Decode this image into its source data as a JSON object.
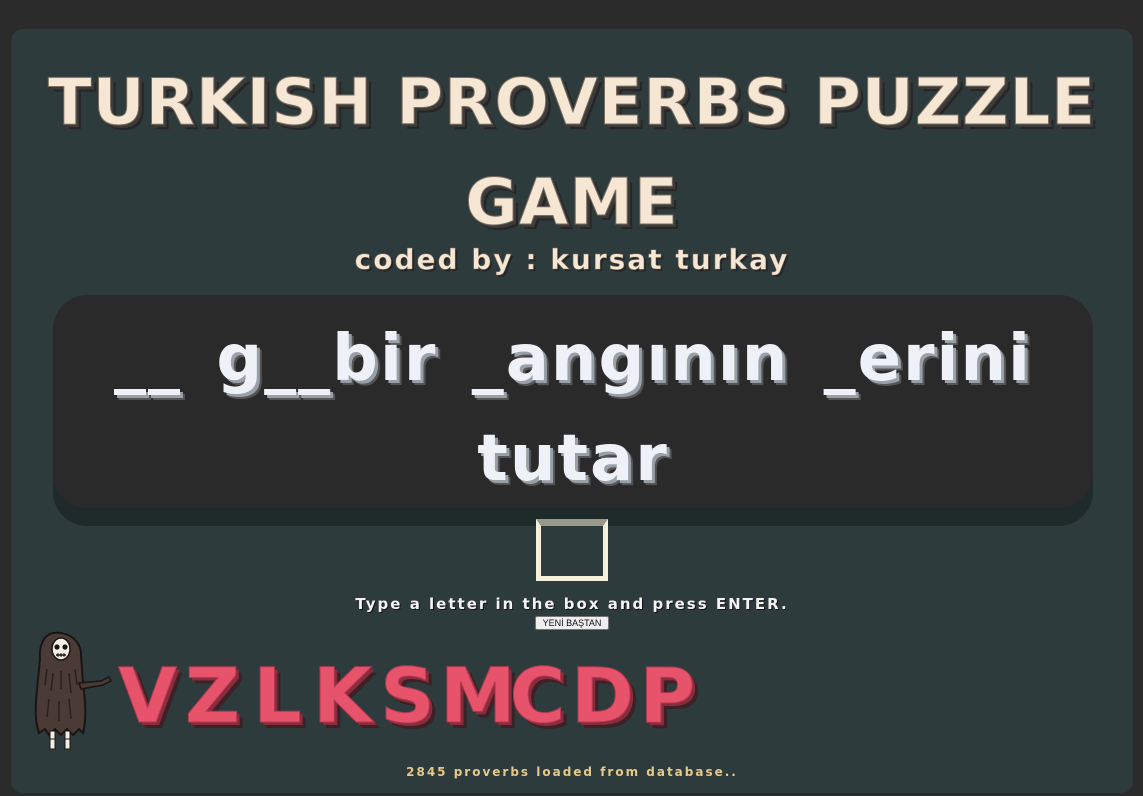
{
  "game": {
    "title": "TURKISH PROVERBS PUZZLE GAME",
    "subtitle": "coded by : kursat turkay",
    "puzzle_text": "__ g__bir _angının _erini tutar",
    "instruction": "Type a letter in the box and press ENTER.",
    "reset_label": "YENİ BAŞTAN",
    "status": "2845 proverbs loaded from database..",
    "letter_input_value": ""
  },
  "wrong_letters": [
    "V",
    "Z",
    "L",
    "K",
    "S",
    "M",
    "C",
    "D",
    "P"
  ],
  "colors": {
    "page_bg": "#2b2b2b",
    "card_bg": "#2e3b3d",
    "board_bg": "#2a2a2a",
    "title": "#f6e7d4",
    "puzzle_text": "#eef2f8",
    "wrong_letter": "#e8536c",
    "status": "#e6c88a"
  },
  "icons": {
    "hangman": "hooded-monster-icon"
  }
}
